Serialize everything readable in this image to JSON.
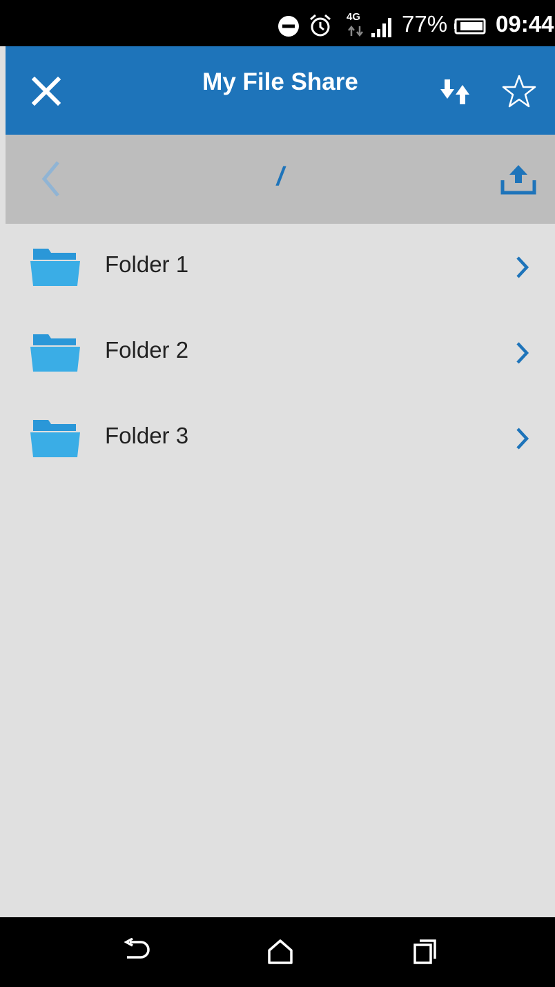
{
  "status_bar": {
    "network": "4G",
    "battery": "77%",
    "time": "09:44",
    "icons": [
      "do-not-disturb-icon",
      "alarm-icon",
      "network-4g-icon",
      "signal-icon",
      "battery-icon"
    ]
  },
  "app_bar": {
    "title": "My File Share",
    "icons": [
      "close-icon",
      "transfer-icon",
      "star-icon"
    ]
  },
  "path_bar": {
    "path": "/",
    "icons": [
      "back-chevron-icon",
      "upload-icon"
    ]
  },
  "folders": [
    {
      "label": "Folder 1"
    },
    {
      "label": "Folder 2"
    },
    {
      "label": "Folder 3"
    }
  ],
  "nav_bar": {
    "icons": [
      "back-icon",
      "home-icon",
      "recents-icon"
    ]
  },
  "colors": {
    "accent": "#1e74ba",
    "folder": "#3aade6",
    "path_bar": "#bdbdbd",
    "background": "#e0e0e0"
  }
}
